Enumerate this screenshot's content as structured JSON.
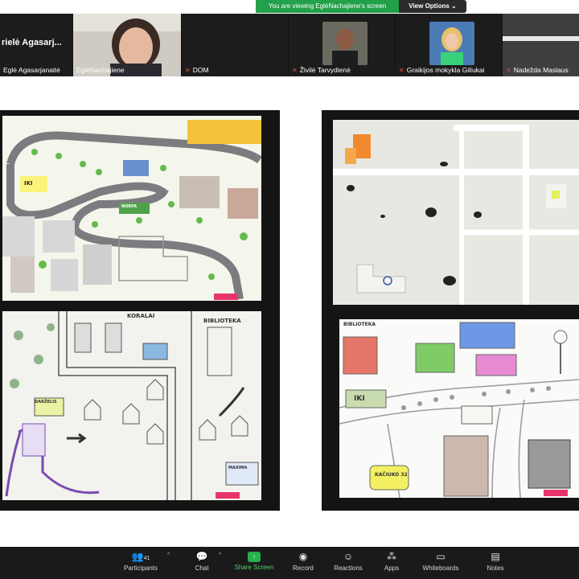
{
  "banner": {
    "message": "You are viewing EglėNachajiene's screen",
    "view_options": "View Options",
    "accent": "#23a04a"
  },
  "participants": [
    {
      "name": "Eglė Agasarjanaitė",
      "big_label": "rielė Agasarj...",
      "muted": false
    },
    {
      "name": "EglėNachajiene",
      "muted": false
    },
    {
      "name": "DOM",
      "muted": true
    },
    {
      "name": "Živilė Tarvydienė",
      "muted": true
    },
    {
      "name": "Graikijos mokykla Giliukai",
      "muted": true
    },
    {
      "name": "Nadežda Maslaus",
      "muted": true
    }
  ],
  "shared_screen": {
    "drawings": {
      "koralai": "KORALAI",
      "biblioteka": "BIBLIOTEKA",
      "iki": "IKI",
      "biblioteka2": "BIBLIOTEKA",
      "kaciuko": "KAČIUKO 32",
      "norfa": "NORFA",
      "maxima": "MAXIMA",
      "darzelis": "DARŽELIS"
    }
  },
  "toolbar": {
    "participants_label": "Participants",
    "participants_count": "41",
    "chat": "Chat",
    "share": "Share Screen",
    "record": "Record",
    "reactions": "Reactions",
    "apps": "Apps",
    "whiteboards": "Whiteboards",
    "notes": "Notes"
  }
}
